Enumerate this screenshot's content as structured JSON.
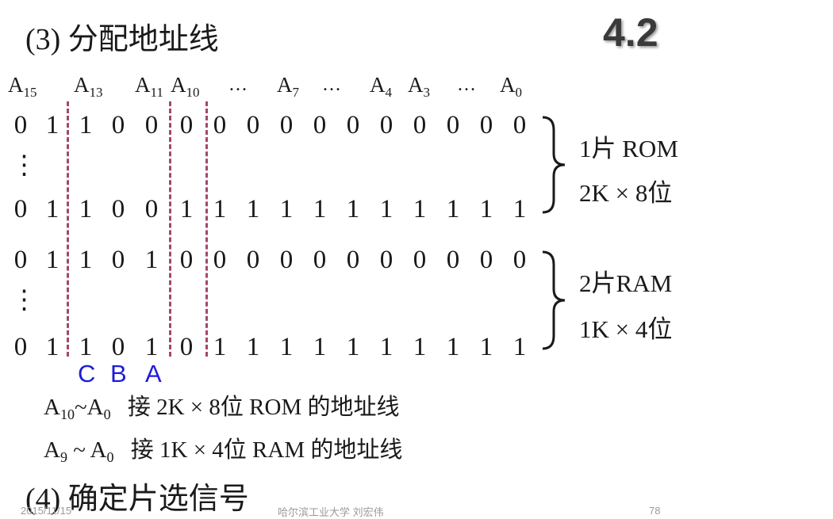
{
  "section3_title": "(3) 分配地址线",
  "section4_title": "(4) 确定片选信号",
  "slide_badge": "4.2",
  "address_labels": [
    {
      "base": "A",
      "sub": "15"
    },
    {
      "base": "A",
      "sub": "13"
    },
    {
      "base": "A",
      "sub": "11"
    },
    {
      "base": "A",
      "sub": "10"
    },
    {
      "base": "A",
      "sub": "7"
    },
    {
      "base": "A",
      "sub": "4"
    },
    {
      "base": "A",
      "sub": "3"
    },
    {
      "base": "A",
      "sub": "0"
    }
  ],
  "ellipsis": "…",
  "rows": [
    [
      "0",
      "1",
      "1",
      "0",
      "0",
      "0",
      "0",
      "0",
      "0",
      "0",
      "0",
      "0",
      "0",
      "0",
      "0",
      "0"
    ],
    [
      "0",
      "1",
      "1",
      "0",
      "0",
      "1",
      "1",
      "1",
      "1",
      "1",
      "1",
      "1",
      "1",
      "1",
      "1",
      "1"
    ],
    [
      "0",
      "1",
      "1",
      "0",
      "1",
      "0",
      "0",
      "0",
      "0",
      "0",
      "0",
      "0",
      "0",
      "0",
      "0",
      "0"
    ],
    [
      "0",
      "1",
      "1",
      "0",
      "1",
      "0",
      "1",
      "1",
      "1",
      "1",
      "1",
      "1",
      "1",
      "1",
      "1",
      "1"
    ]
  ],
  "vdots": "⋮",
  "rom_group": {
    "line1": "1片 ROM",
    "line2": "2K × 8位"
  },
  "ram_group": {
    "line1": "2片RAM",
    "line2": "1K × 4位"
  },
  "select_labels": [
    "C",
    "B",
    "A"
  ],
  "notes": [
    {
      "from": {
        "base": "A",
        "sub": "10"
      },
      "sep": "~",
      "to": {
        "base": "A",
        "sub": "0"
      },
      "text": "接 2K × 8位 ROM 的地址线"
    },
    {
      "from": {
        "base": "A",
        "sub": "9"
      },
      "sep": " ~ ",
      "to": {
        "base": "A",
        "sub": "0"
      },
      "text": "接 1K × 4位 RAM 的地址线"
    }
  ],
  "footer": {
    "date": "2015/11/15",
    "author": "哈尔滨工业大学  刘宏伟",
    "page": "78"
  }
}
